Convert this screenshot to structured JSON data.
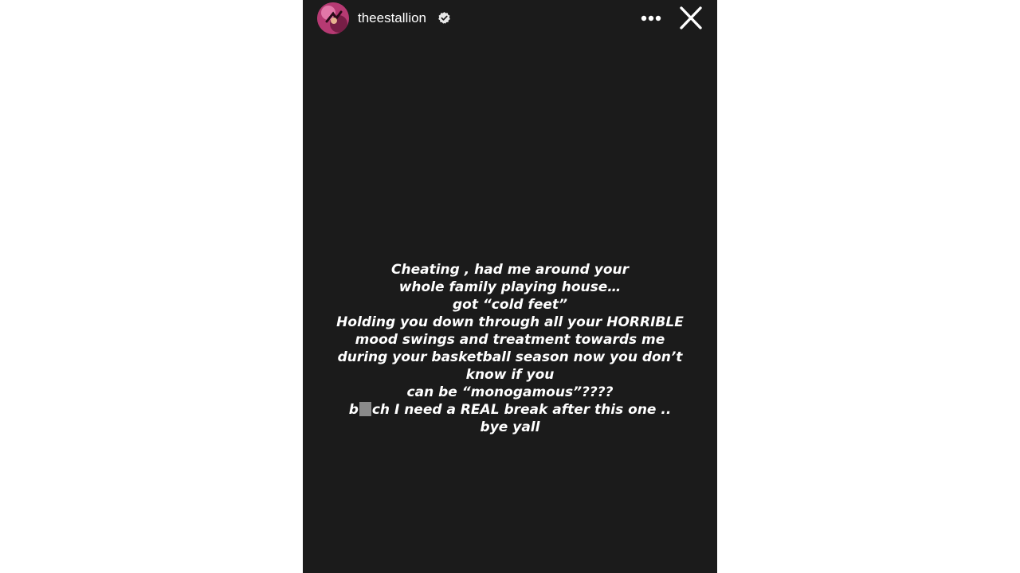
{
  "story": {
    "username": "theestallion",
    "verified": true,
    "avatar_icon": "profile-photo",
    "header_actions": [
      {
        "name": "more-options",
        "icon": "ellipsis-horizontal-icon"
      },
      {
        "name": "close",
        "icon": "close-icon"
      }
    ],
    "background_color": "#1b1b1b",
    "text_color": "#ffffff",
    "redaction_color": "#8a8a8a",
    "lines": [
      "Cheating , had me around your",
      "whole family playing house…",
      "got “cold feet”",
      "Holding you down through all your HORRIBLE",
      "mood swings and treatment towards me",
      "during your basketball season now you don’t",
      "know if you",
      "can be “monogamous”????"
    ],
    "censored_line": {
      "prefix": "b",
      "suffix": "ch I need a REAL break after this one .."
    },
    "last_line": "bye yall"
  }
}
